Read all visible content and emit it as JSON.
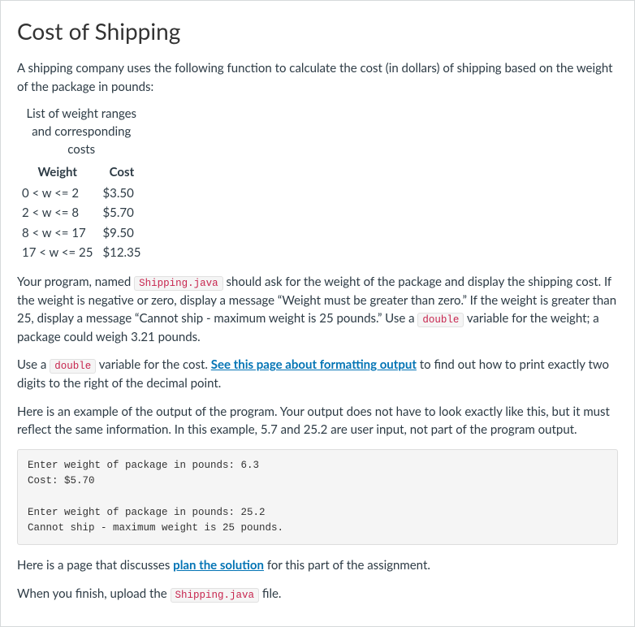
{
  "title": "Cost of Shipping",
  "intro": "A shipping company uses the following function to calculate the cost (in dollars) of shipping based on the weight of the package in pounds:",
  "table": {
    "caption": "List of weight ranges and corresponding costs",
    "headers": {
      "range": "Weight",
      "cost": "Cost"
    },
    "rows": [
      {
        "range": "0 < w <= 2",
        "cost": "$3.50"
      },
      {
        "range": "2 < w <= 8",
        "cost": "$5.70"
      },
      {
        "range": "8 < w <= 17",
        "cost": "$9.50"
      },
      {
        "range": "17 < w <= 25",
        "cost": "$12.35"
      }
    ]
  },
  "prog": {
    "p1a": "Your program, named ",
    "code_shipping": "Shipping.java",
    "p1b": " should ask for the weight of the package and display the shipping cost. If the weight is negative or zero, display a message “Weight must be greater than zero.” If the weight is greater than 25, display a message “Cannot ship - maximum weight is 25 pounds.” Use a ",
    "code_double1": "double",
    "p1c": " variable for the weight; a package could weigh 3.21 pounds."
  },
  "fmt": {
    "p2a": "Use a ",
    "code_double2": "double",
    "p2b": " variable for the cost. ",
    "link_text": "See this page about formatting output",
    "p2c": " to find out how to print exactly two digits to the right of the decimal point."
  },
  "example_intro": "Here is an example of the output of the program. Your output does not have to look exactly like this, but it must reflect the same information. In this example, 5.7 and 25.2 are user input, not part of the program output.",
  "sample_output": "Enter weight of package in pounds: 6.3\nCost: $5.70\n\nEnter weight of package in pounds: 25.2\nCannot ship - maximum weight is 25 pounds.",
  "plan": {
    "p3a": "Here is a page that discusses ",
    "link_text": "plan the solution",
    "p3b": " for this part of the assignment."
  },
  "finish": {
    "p4a": "When you finish, upload the ",
    "code_shipping2": "Shipping.java",
    "p4b": " file."
  }
}
